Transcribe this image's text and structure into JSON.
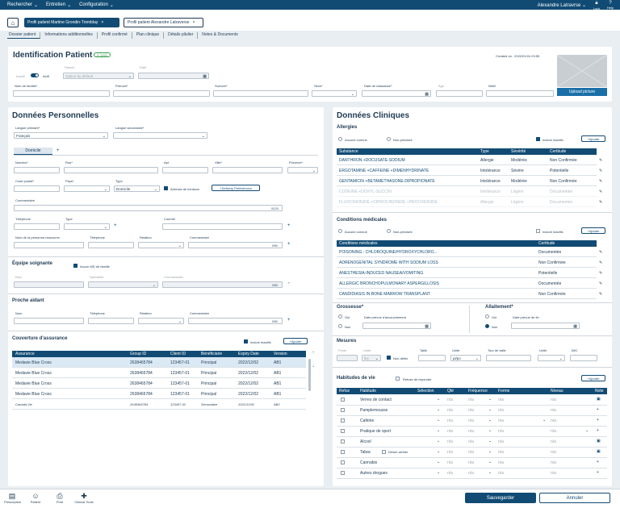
{
  "topbar": {
    "menus": [
      "Rechercher",
      "Entretien",
      "Configuration"
    ],
    "user": "Alexandre Latravrse",
    "lock": "Lock",
    "help": "Help"
  },
  "patient_tabs": [
    {
      "label": "Profil patient Martine Grondin-Tremblay"
    },
    {
      "label": "Profil patient Alexandre Latraverse"
    }
  ],
  "subnav": [
    "Dossier patient",
    "Informations additionnelles",
    "Profil confirmé",
    "Plan clinique",
    "Détails pilulier",
    "Notes & Documents"
  ],
  "identification": {
    "title": "Identification Patient",
    "badge": "DSS",
    "created": "Created on : 2022/01/24 23:55",
    "inactif": "Inactif",
    "actif": "Actif",
    "raison_label": "Raison",
    "raison_placeholder": "Option by default",
    "date_label": "Date",
    "nom_label": "Nom de famille*",
    "prenom_label": "Prénom*",
    "surnom_label": "Surnom*",
    "sexe_label": "Sexe*",
    "ddn_label": "Date de naissance*",
    "age_label": "Âge",
    "nam_label": "NAM",
    "upload": "Upload picture"
  },
  "perso": {
    "title": "Données Personnelles",
    "lang1_label": "Langue primaire*",
    "lang1_value": "Français",
    "lang2_label": "Langue secondaire*",
    "domicile_tab": "Domicile",
    "numero": "Numéro*",
    "rue": "Rue*",
    "apt": "Apt",
    "ville": "Ville*",
    "province": "Province*",
    "code_postal": "Code postal*",
    "pays": "Pays*",
    "type_label": "Type",
    "type_value": "Domicile",
    "livraison": "Adresse de livraison",
    "delivery": "Delivery Preferences",
    "commentaire": "Commentaire",
    "count1": "0/120",
    "telephone": "Téléphone",
    "type2": "Type",
    "courriel": "Courriel",
    "personne": "Nom de la personne-ressource",
    "tel2": "Téléphone",
    "relation": "Relation",
    "commentaire2": "Commentaire",
    "count2": "0/50"
  },
  "equipe": {
    "title": "Équipe soignante",
    "aucun": "Aucun MD de famille",
    "nom": "Nom",
    "specialite": "Spécialité",
    "commentaire": "Commentaire",
    "count": "0/50"
  },
  "proche": {
    "title": "Proche aidant",
    "nom": "Nom",
    "tel": "Téléphone",
    "relation": "Relation",
    "commentaire": "Commentaire",
    "count": "0/50"
  },
  "couverture": {
    "title": "Couverture d'assurance",
    "inclure": "Inclure inactifs",
    "ajouter": "Ajouter",
    "headers": [
      "Assurance",
      "Group ID",
      "Client ID",
      "Bénéficiaire",
      "Expiry Date",
      "Version"
    ],
    "rows": [
      [
        "Medavie Blue Cross",
        "2638465784",
        "123457-01",
        "Principal",
        "2022/12/02",
        "AB1"
      ],
      [
        "Medavie Blue Cross",
        "2638465784",
        "123457-01",
        "Principal",
        "2022/12/02",
        "AB1"
      ],
      [
        "Medavie Blue Cross",
        "2638465784",
        "123457-01",
        "Principal",
        "2022/12/02",
        "AB1"
      ],
      [
        "Medavie Blue Cross",
        "2638465784",
        "123457-01",
        "Principal",
        "2022/12/02",
        "AB1"
      ],
      [
        "Canada Vie",
        "2638465784",
        "123457-02",
        "Secondaire",
        "2021/12/02",
        "AB2"
      ]
    ]
  },
  "cliniques": {
    "title": "Données Cliniques"
  },
  "allergies": {
    "title": "Allergies",
    "aucune": "Aucune connue",
    "non": "Non-précisée",
    "inclure": "Inclure inactifs",
    "ajouter": "Ajouter",
    "headers": [
      "Substance",
      "Type",
      "Sévérité",
      "Certitude"
    ],
    "rows": [
      [
        "DANTHRON +DOCUSATE-SODIUM",
        "Allergie",
        "Modérée",
        "Non Confirmée"
      ],
      [
        "ERGOTAMINE +CAFFEINE +DIMENHYDRINATE",
        "Intolérance",
        "Sévère",
        "Potentielle"
      ],
      [
        "GENTAMICIN +BETAMETHASONE-DIPROPIONATE",
        "Intolérance",
        "Modérée",
        "Non Confirmée"
      ],
      [
        "CODEINE +DOXYL-SUCCIN",
        "Intolérance",
        "Légère",
        "Documentée"
      ],
      [
        "FLUOCINONIDE +CIPROCINONIDE +PROCINONIDE",
        "Allergie",
        "Légère",
        "Documentée"
      ]
    ]
  },
  "conditions": {
    "title": "Conditions médicales",
    "aucune": "Aucune connue",
    "non": "Non-précisée",
    "inclure": "Inclure inactifs",
    "ajouter": "Ajouter",
    "headers": [
      "Conditions médicales",
      "Certitude"
    ],
    "rows": [
      [
        "POISONING - CHLOROQUINE/HYDROXYCHLORO...",
        "Documentée"
      ],
      [
        "ADRENOGENITAL SYNDROME WITH SODIUM LOSS",
        "Non Confirmée"
      ],
      [
        "ANESTHESIA-INDUCED NAUSEA/VOMITING",
        "Potentielle"
      ],
      [
        "ALLERGIC BRONCHOPULMONARY ASPERGILLOSIS",
        "Documentée"
      ],
      [
        "CANDIDIASIS IN BONE MARROW TRANSPLANT",
        "Non Confirmée"
      ]
    ]
  },
  "grossesse": {
    "title": "Grossesse*",
    "oui": "Oui",
    "non": "Non",
    "date": "Date prévue d'accouchement"
  },
  "allaitement": {
    "title": "Allaitement*",
    "oui": "Oui",
    "non": "Non",
    "date": "Date prévue de fin"
  },
  "mesures": {
    "title": "Mesures",
    "poids": "Poids",
    "unite": "Unité",
    "unite_val": "lbs",
    "non_defini": "Non défini",
    "taille": "Taille",
    "unite2": "Unité",
    "unite2_val": "pi/po",
    "tour": "Tour de taille",
    "unite3": "Unité",
    "imc": "IMC"
  },
  "habitudes": {
    "title": "Habitudes de vie",
    "refuse": "Refuse de répondre",
    "ajouter": "Ajouter",
    "headers": [
      "Refus",
      "Habitude",
      "Sélection",
      "Qté",
      "Fréquence",
      "Forme",
      "Niveau",
      "Note"
    ],
    "na": "n/a",
    "desire": "Désire arrêter",
    "rows": [
      "Verres de contact",
      "Pamplemousse",
      "Caféine",
      "Pratique de sport",
      "Alcool",
      "Tabac",
      "Cannabis",
      "Autres drogues"
    ]
  },
  "bottom": {
    "items": [
      "Prescription",
      "Patient",
      "Print",
      "Clinical Tools"
    ],
    "save": "Sauvegarder",
    "cancel": "Annuler"
  }
}
